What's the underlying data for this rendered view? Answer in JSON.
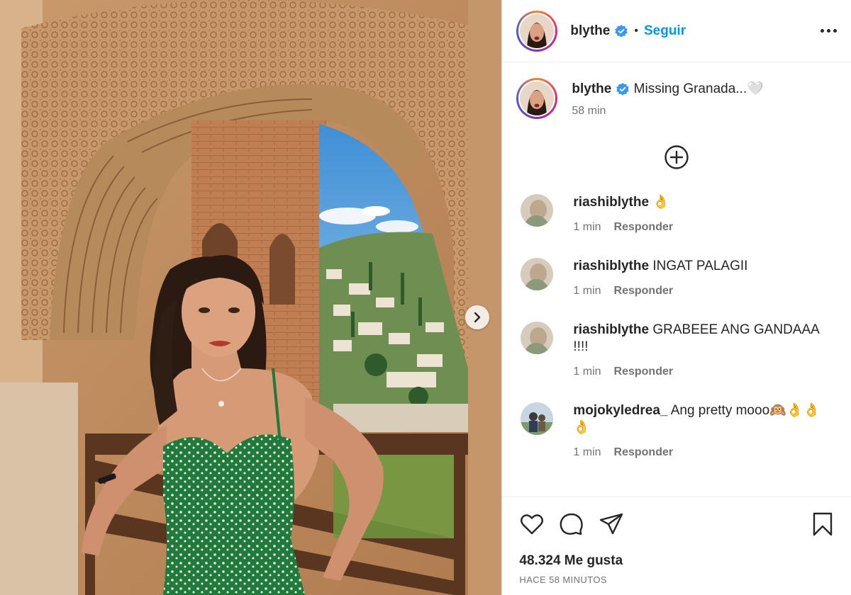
{
  "post": {
    "author": "blythe",
    "follow_label": "Seguir",
    "separator": "•",
    "caption": "Missing Granada...🤍",
    "caption_time": "58 min"
  },
  "comments": [
    {
      "user": "riashiblythe",
      "text": "👌",
      "time": "1 min",
      "reply": "Responder"
    },
    {
      "user": "riashiblythe",
      "text": "INGAT PALAGII",
      "time": "1 min",
      "reply": "Responder"
    },
    {
      "user": "riashiblythe",
      "text": "GRABEEE ANG GANDAAA !!!!",
      "time": "1 min",
      "reply": "Responder"
    },
    {
      "user": "mojokyledrea_",
      "text": "Ang pretty mooo🙉👌👌👌",
      "time": "1 min",
      "reply": "Responder"
    }
  ],
  "footer": {
    "likes": "48.324 Me gusta",
    "timestamp": "HACE 58 MINUTOS"
  },
  "icons": {
    "verified": "verified-badge-icon",
    "more": "more-options-icon",
    "add_comment": "plus-circle-icon",
    "like": "heart-icon",
    "comment": "comment-bubble-icon",
    "share": "paper-plane-icon",
    "save": "bookmark-icon",
    "next": "chevron-right-icon"
  },
  "colors": {
    "accent": "#0095f6",
    "verified": "#3897f0",
    "text": "#262626",
    "muted": "#737373"
  }
}
